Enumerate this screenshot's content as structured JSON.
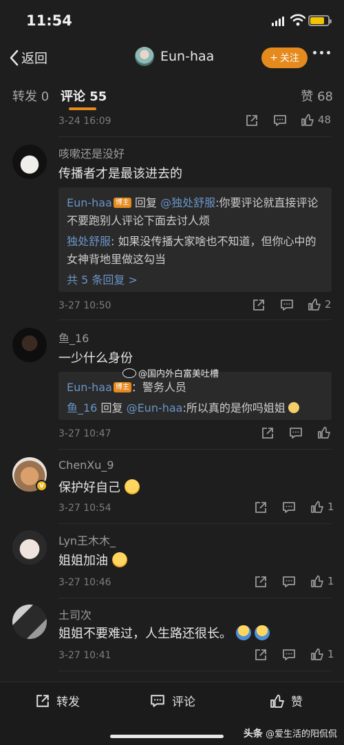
{
  "status": {
    "time": "11:54"
  },
  "nav": {
    "back_label": "返回",
    "user_name": "Eun-haa",
    "follow_label": "关注"
  },
  "tabs": {
    "repost": "转发 0",
    "comments": "评论 55",
    "likes": "赞 68"
  },
  "top_meta": {
    "time": "3-24 16:09",
    "like_count": "48"
  },
  "comments": [
    {
      "user": "咳嗽还是没好",
      "text": "传播者才是最该进去的",
      "replies": [
        {
          "user": "Eun-haa",
          "badge": "博主",
          "text_prefix": " 回复 ",
          "mention": "@独处舒服",
          "text": ":你要评论就直接评论 不要跑别人评论下面去讨人烦"
        },
        {
          "user": "独处舒服",
          "text": ": 如果没传播大家啥也不知道，但你心中的女神背地里做这勾当"
        }
      ],
      "more_replies": "共 5 条回复 >",
      "time": "3-27 10:50",
      "like_count": "2"
    },
    {
      "user": "鱼_16",
      "text": "一少什么身份",
      "replies": [
        {
          "user": "Eun-haa",
          "badge": "博主",
          "text": "：警务人员"
        },
        {
          "user": "鱼_16",
          "text_prefix": " 回复 ",
          "mention": "@Eun-haa",
          "text": ":所以真的是你吗姐姐"
        }
      ],
      "time": "3-27 10:47",
      "like_count": ""
    },
    {
      "user": "ChenXu_9",
      "text": "保护好自己",
      "time": "3-27 10:54",
      "like_count": "1",
      "vbadge": "V"
    },
    {
      "user": "Lyn王木木_",
      "text": "姐姐加油",
      "time": "3-27 10:46",
      "like_count": "1"
    },
    {
      "user": "土司次",
      "text": "姐姐不要难过，人生路还很长。",
      "time": "3-27 10:41",
      "like_count": "1"
    }
  ],
  "watermark_mid": "@国内外白富美吐槽",
  "bottom_bar": {
    "repost": "转发",
    "comment": "评论",
    "like": "赞"
  },
  "watermark_bottom": {
    "brand": "头条",
    "account": "@爱生活的阳侃侃"
  },
  "colors": {
    "background": "#1e1e1e",
    "accent": "#e58a1d",
    "link": "#6a95c8"
  }
}
